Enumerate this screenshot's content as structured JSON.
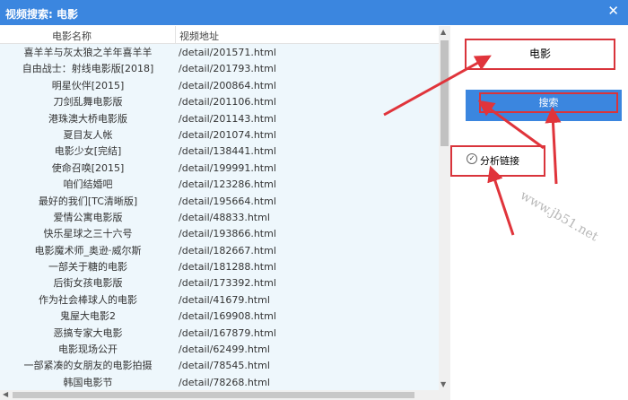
{
  "window": {
    "title": "视频搜索: 电影",
    "close_glyph": "✕"
  },
  "list": {
    "columns": [
      "电影名称",
      "视频地址"
    ],
    "rows": [
      [
        "喜羊羊与灰太狼之羊年喜羊羊",
        "/detail/201571.html"
      ],
      [
        "自由战士：射线电影版[2018]",
        "/detail/201793.html"
      ],
      [
        "明星伙伴[2015]",
        "/detail/200864.html"
      ],
      [
        "刀剑乱舞电影版",
        "/detail/201106.html"
      ],
      [
        "港珠澳大桥电影版",
        "/detail/201143.html"
      ],
      [
        "夏目友人帐",
        "/detail/201074.html"
      ],
      [
        "电影少女[完结]",
        "/detail/138441.html"
      ],
      [
        "使命召唤[2015]",
        "/detail/199991.html"
      ],
      [
        "咱们结婚吧",
        "/detail/123286.html"
      ],
      [
        "最好的我们[TC清晰版]",
        "/detail/195664.html"
      ],
      [
        "爱情公寓电影版",
        "/detail/48833.html"
      ],
      [
        "快乐星球之三十六号",
        "/detail/193866.html"
      ],
      [
        "电影魔术师_奥逊·威尔斯",
        "/detail/182667.html"
      ],
      [
        "一部关于糖的电影",
        "/detail/181288.html"
      ],
      [
        "后街女孩电影版",
        "/detail/173392.html"
      ],
      [
        "作为社会棒球人的电影",
        "/detail/41679.html"
      ],
      [
        "鬼屋大电影2",
        "/detail/169908.html"
      ],
      [
        "恶搞专家大电影",
        "/detail/167879.html"
      ],
      [
        "电影现场公开",
        "/detail/62499.html"
      ],
      [
        "一部紧凑的女朋友的电影拍摄",
        "/detail/78545.html"
      ],
      [
        "韩国电影节",
        "/detail/78268.html"
      ]
    ]
  },
  "search": {
    "value": "电影",
    "button_label": "搜索"
  },
  "analyze": {
    "checkbox_glyph": "✓",
    "label": "分析链接"
  },
  "watermark": "www.jb51.net",
  "scroll": {
    "up_glyph": "▲",
    "down_glyph": "▼",
    "left_glyph": "◀"
  },
  "colors": {
    "title_bar": "#3b86df",
    "highlight": "#d9343b",
    "list_bg": "#eef7fc"
  }
}
